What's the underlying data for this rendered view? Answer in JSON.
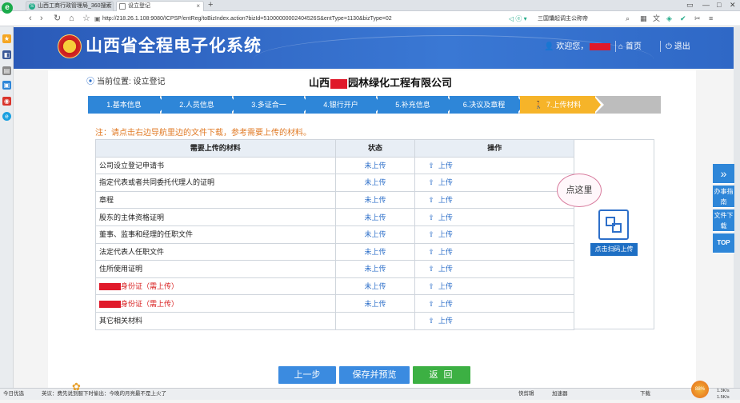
{
  "browser": {
    "tabs": [
      {
        "label": "山西工商行政管理局_360搜索",
        "active": false
      },
      {
        "label": "设立登记",
        "active": true
      }
    ],
    "new_tab": "+",
    "address": "http://218.26.1.108:9080/ICPSP/entReg/toBizIndex.action?bizId=51000000002404526S&entType=1130&bizType=02",
    "search_text": "三国馕起调主公称帝",
    "colors": {
      "accent": "#1aab4b"
    }
  },
  "header": {
    "title": "山西省全程电子化系统",
    "welcome": "欢迎您，",
    "home": "首页",
    "exit": "退出"
  },
  "location": {
    "label": "当前位置: 设立登记"
  },
  "company": {
    "prefix": "山西",
    "suffix": "园林绿化工程有限公司"
  },
  "steps": [
    {
      "label": "1.基本信息",
      "state": "done"
    },
    {
      "label": "2.人员信息",
      "state": "done"
    },
    {
      "label": "3.多证合一",
      "state": "done"
    },
    {
      "label": "4.银行开户",
      "state": "done"
    },
    {
      "label": "5.补充信息",
      "state": "done"
    },
    {
      "label": "6.决议及章程",
      "state": "done"
    },
    {
      "label": "7.上传材料",
      "state": "current"
    }
  ],
  "note": "注：请点击右边导航里边的文件下载，参考需要上传的材料。",
  "table": {
    "headers": [
      "需要上传的材料",
      "状态",
      "操作"
    ],
    "rows": [
      {
        "name": "公司设立登记申请书",
        "status": "未上传",
        "action": "上传"
      },
      {
        "name": "指定代表或者共同委托代理人的证明",
        "status": "未上传",
        "action": "上传"
      },
      {
        "name": "章程",
        "status": "未上传",
        "action": "上传"
      },
      {
        "name": "股东的主体资格证明",
        "status": "未上传",
        "action": "上传"
      },
      {
        "name": "董事、监事和经理的任职文件",
        "status": "未上传",
        "action": "上传"
      },
      {
        "name": "法定代表人任职文件",
        "status": "未上传",
        "action": "上传"
      },
      {
        "name": "住所使用证明",
        "status": "未上传",
        "action": "上传"
      },
      {
        "name": "身份证（需上传）",
        "status": "未上传",
        "action": "上传"
      },
      {
        "name": "身份证（需上传）",
        "status": "未上传",
        "action": "上传"
      },
      {
        "name": "其它相关材料",
        "status": "",
        "action": "上传"
      }
    ]
  },
  "qr_panel": {
    "bubble": "点这里",
    "scan_button": "点击扫码上传"
  },
  "buttons": {
    "prev": "上一步",
    "save": "保存并预览",
    "back": "返 回"
  },
  "float_nav": {
    "guide": "办事指南",
    "download": "文件下载",
    "top": "TOP"
  },
  "statusbar": {
    "left": "今日优选",
    "news": "英议：费先说到服下时偷出：今晚的月亮最不是上火了",
    "items": [
      "快剪辑",
      "加速器",
      "下载"
    ],
    "speed_up": "1.3K/s",
    "speed_down": "1.5K/s",
    "orb": "88%"
  }
}
